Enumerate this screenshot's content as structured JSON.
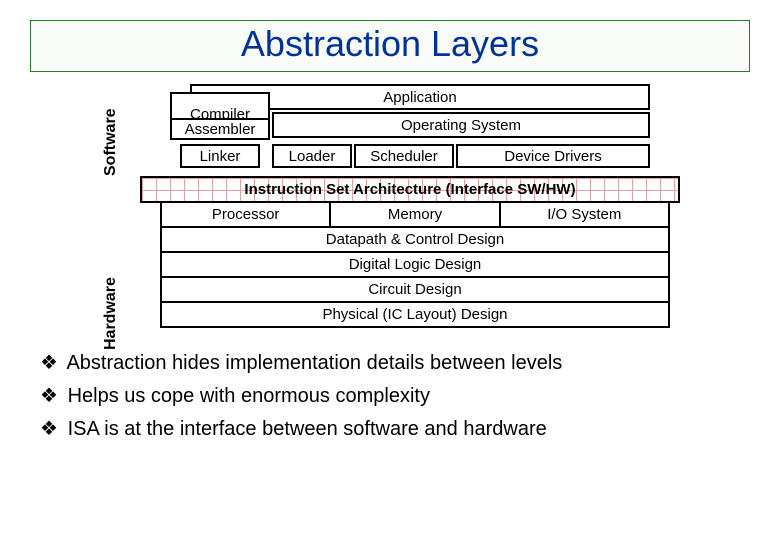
{
  "title": "Abstraction Layers",
  "labels": {
    "software": "Software",
    "hardware": "Hardware"
  },
  "sw": {
    "application": "Application",
    "compiler": "Compiler",
    "assembler": "Assembler",
    "os": "Operating System",
    "linker": "Linker",
    "loader": "Loader",
    "scheduler": "Scheduler",
    "drivers": "Device Drivers"
  },
  "isa": "Instruction Set Architecture (Interface SW/HW)",
  "hw": {
    "processor": "Processor",
    "memory": "Memory",
    "io": "I/O System",
    "datapath": "Datapath & Control Design",
    "digital": "Digital Logic Design",
    "circuit": "Circuit Design",
    "physical": "Physical (IC Layout) Design"
  },
  "bullets": {
    "b1": "Abstraction hides implementation details between levels",
    "b2": "Helps us cope with enormous complexity",
    "b3": "ISA is at the interface between software and hardware"
  },
  "glyph": {
    "diamond": "❖"
  }
}
